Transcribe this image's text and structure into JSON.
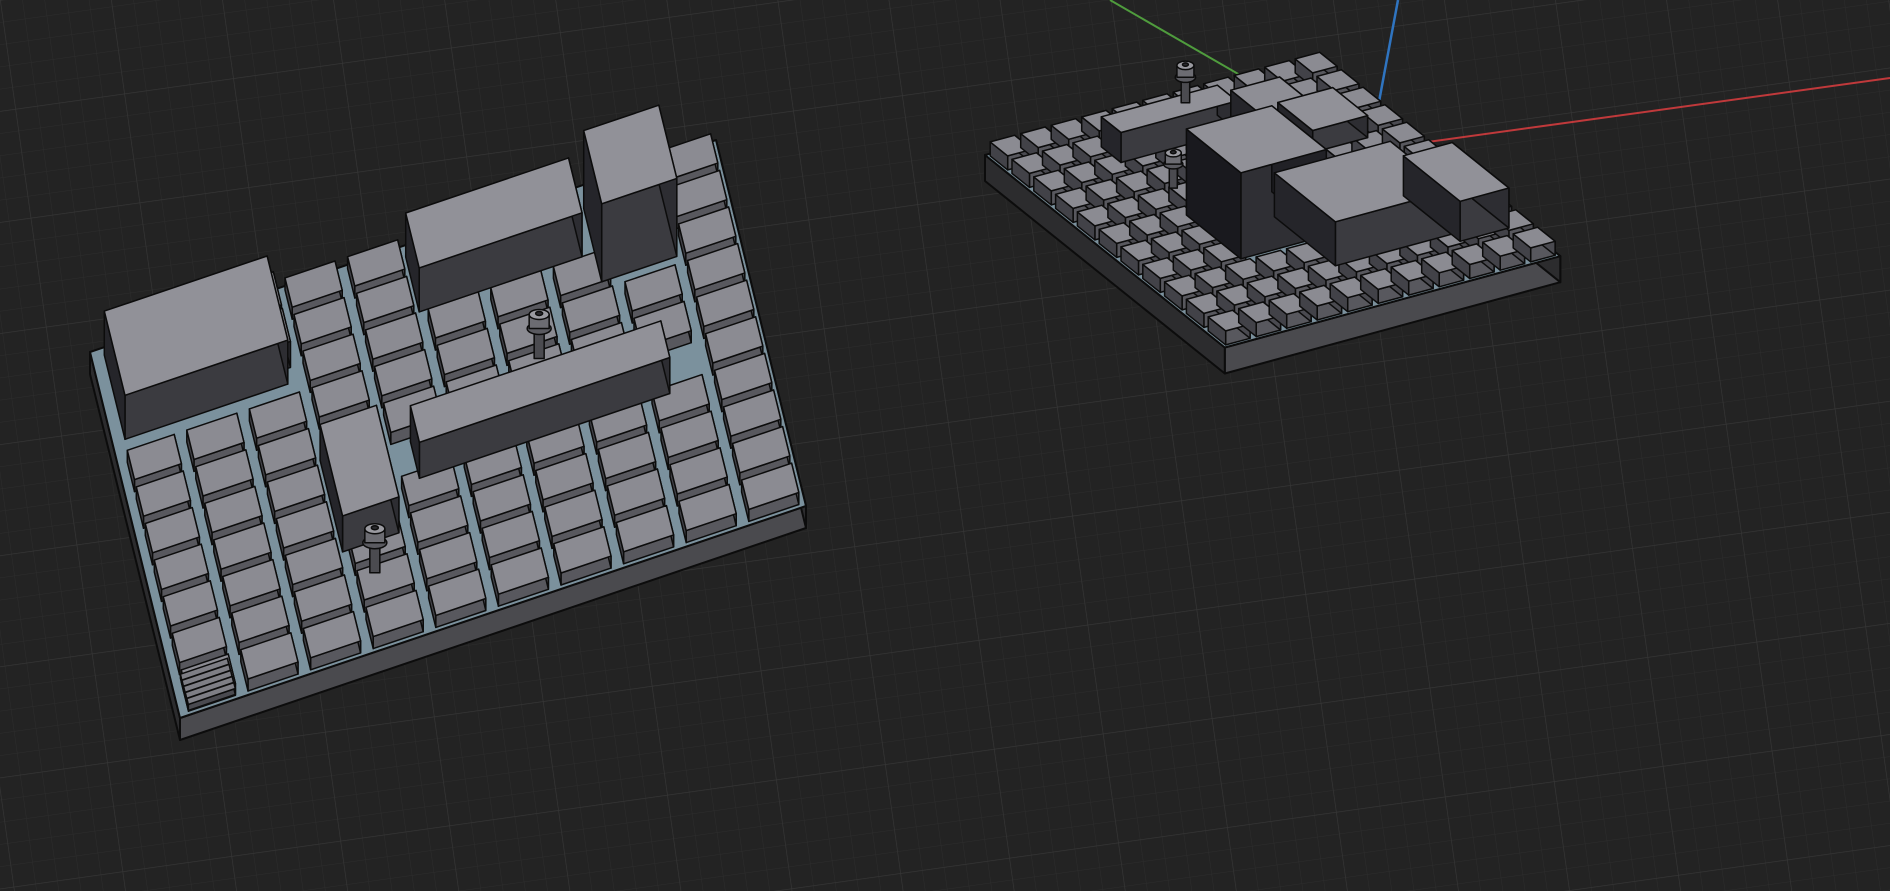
{
  "viewport": {
    "mode": "3d-viewport",
    "grid": true,
    "axes": [
      "x",
      "y",
      "z"
    ]
  },
  "colors": {
    "background": "#232323",
    "grid_line": "#2e2e2e",
    "plate_top": "#7b919d",
    "plate_side": "#2c2c2e",
    "plate_front": "#4a4a4e",
    "tile_top": "#8b8b92",
    "tile_side": "#58585e",
    "block_top": "#919198",
    "block_side": "#3b3b40",
    "axis_x": "#c0393b",
    "axis_y": "#4f9c3d",
    "axis_z": "#2f74c0",
    "outline": "#0c0c0c"
  },
  "icons": [
    "x-axis-line",
    "y-axis-line",
    "z-axis-line",
    "grid-floor"
  ]
}
